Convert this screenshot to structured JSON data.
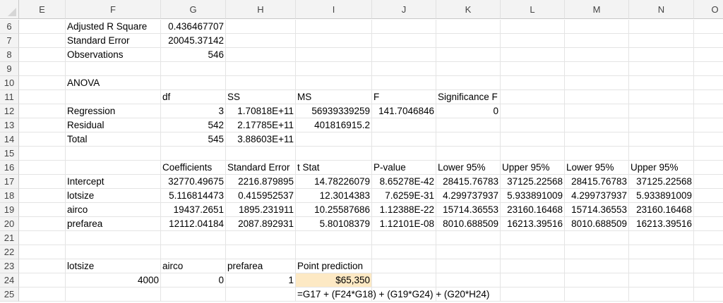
{
  "columns": [
    "E",
    "F",
    "G",
    "H",
    "I",
    "J",
    "K",
    "L",
    "M",
    "N",
    "O"
  ],
  "rows": [
    {
      "n": "6",
      "cells": {
        "F": "Adjusted R Square",
        "G": "0.436467707"
      }
    },
    {
      "n": "7",
      "cells": {
        "F": "Standard Error",
        "G": "20045.37142"
      }
    },
    {
      "n": "8",
      "cells": {
        "F": "Observations",
        "G": "546"
      }
    },
    {
      "n": "9",
      "cells": {}
    },
    {
      "n": "10",
      "cells": {
        "F": "ANOVA"
      }
    },
    {
      "n": "11",
      "cells": {
        "G": "df",
        "H": "SS",
        "I": "MS",
        "J": "F",
        "K": "Significance F"
      }
    },
    {
      "n": "12",
      "cells": {
        "F": "Regression",
        "G": "3",
        "H": "1.70818E+11",
        "I": "56939339259",
        "J": "141.7046846",
        "K": "0"
      }
    },
    {
      "n": "13",
      "cells": {
        "F": "Residual",
        "G": "542",
        "H": "2.17785E+11",
        "I": "401816915.2"
      }
    },
    {
      "n": "14",
      "cells": {
        "F": "Total",
        "G": "545",
        "H": "3.88603E+11"
      }
    },
    {
      "n": "15",
      "cells": {}
    },
    {
      "n": "16",
      "cells": {
        "G": "Coefficients",
        "H": "Standard Error",
        "I": "t Stat",
        "J": "P-value",
        "K": "Lower 95%",
        "L": "Upper 95%",
        "M": "Lower 95%",
        "N": "Upper 95%"
      }
    },
    {
      "n": "17",
      "cells": {
        "F": "Intercept",
        "G": "32770.49675",
        "H": "2216.879895",
        "I": "14.78226079",
        "J": "8.65278E-42",
        "K": "28415.76783",
        "L": "37125.22568",
        "M": "28415.76783",
        "N": "37125.22568"
      }
    },
    {
      "n": "18",
      "cells": {
        "F": "lotsize",
        "G": "5.116814473",
        "H": "0.415952537",
        "I": "12.3014383",
        "J": "7.6259E-31",
        "K": "4.299737937",
        "L": "5.933891009",
        "M": "4.299737937",
        "N": "5.933891009"
      }
    },
    {
      "n": "19",
      "cells": {
        "F": "airco",
        "G": "19437.2651",
        "H": "1895.231911",
        "I": "10.25587686",
        "J": "1.12388E-22",
        "K": "15714.36553",
        "L": "23160.16468",
        "M": "15714.36553",
        "N": "23160.16468"
      }
    },
    {
      "n": "20",
      "cells": {
        "F": "prefarea",
        "G": "12112.04184",
        "H": "2087.892931",
        "I": "5.80108379",
        "J": "1.12101E-08",
        "K": "8010.688509",
        "L": "16213.39516",
        "M": "8010.688509",
        "N": "16213.39516"
      }
    },
    {
      "n": "21",
      "cells": {}
    },
    {
      "n": "22",
      "cells": {}
    },
    {
      "n": "23",
      "cells": {
        "F": "lotsize",
        "G": "airco",
        "H": "prefarea",
        "I": "Point prediction"
      }
    },
    {
      "n": "24",
      "cells": {
        "F": "4000",
        "G": "0",
        "H": "1",
        "I": "$65,350"
      }
    },
    {
      "n": "25",
      "cells": {
        "I": "=G17 + (F24*G18) + (G19*G24) + (G20*H24)"
      }
    }
  ],
  "highlight": {
    "cell": "I24",
    "color": "#fde9c4"
  }
}
